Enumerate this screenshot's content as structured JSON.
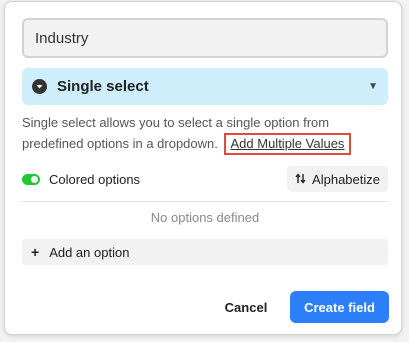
{
  "field_name": {
    "value": "Industry"
  },
  "field_type": {
    "label": "Single select",
    "icon": "chevron-down-circle-icon",
    "dropdown_icon": "caret-down-icon"
  },
  "description": {
    "text": "Single select allows you to select a single option from predefined options in a dropdown.",
    "link": "Add Multiple Values"
  },
  "options": {
    "colored_label": "Colored options",
    "colored_enabled": true,
    "alphabetize_label": "Alphabetize",
    "empty_text": "No options defined",
    "add_label": "Add an option"
  },
  "footer": {
    "cancel_label": "Cancel",
    "create_label": "Create field"
  },
  "colors": {
    "select_bg": "#cdeefa",
    "toggle_on": "#20c933",
    "primary_button": "#2d7ff9",
    "highlight_box": "#e04a3b"
  }
}
